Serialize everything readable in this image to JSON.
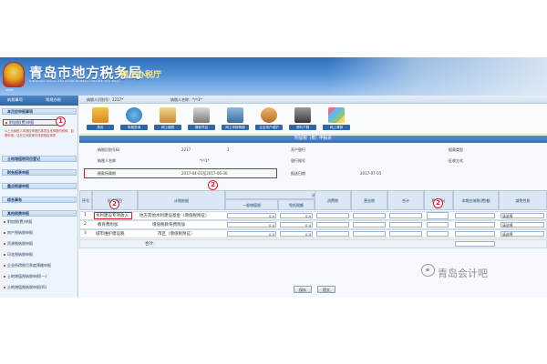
{
  "banner": {
    "title": "青岛市地方税务局",
    "subtitle": "网上办税厅",
    "emblem_text": "QDDS",
    "english": "QINGDAO LOCAL TAXATION BUREAU ONLINE TAX HALL"
  },
  "sidebar": {
    "tabs": [
      "纳税事项",
      "常规办税"
    ],
    "groups": [
      {
        "label": "本月应申报事项"
      },
      {
        "label": "土地增值税项目登记"
      },
      {
        "label": "财务报表申报"
      },
      {
        "label": "重点税源申报"
      },
      {
        "label": "综合事务"
      },
      {
        "label": "其他税费申报"
      }
    ],
    "highlighted_item": "附加税(费)申报",
    "note": "以上为纳税人本期应申报的事项及未申报的税种，如需申报，请在左侧菜单中找到相应事项",
    "items": [
      "附加税(费)申报",
      "房产税纳税申报",
      "资源税纳税申报",
      "印花税纳税申报",
      "企业所得税月季度预缴申报",
      "土地增值税纳税申报(一)",
      "土地增值税纳税申报(四)"
    ]
  },
  "user_bar": {
    "taxpayer_id": "纳税人识别号：2217*",
    "taxpayer_name": "纳税人名称：*户1*"
  },
  "toolbar": {
    "items": [
      {
        "label": "首页",
        "icon": "home-icon"
      },
      {
        "label": "申报查询",
        "icon": "globe-icon"
      },
      {
        "label": "网上缴税",
        "icon": "house-icon"
      },
      {
        "label": "缴款凭证",
        "icon": "printer-icon"
      },
      {
        "label": "网上申报明细",
        "icon": "building-icon"
      },
      {
        "label": "企业用户维护",
        "icon": "users-icon"
      },
      {
        "label": "资料下载",
        "icon": "download-icon"
      },
      {
        "label": "网上清算",
        "icon": "grid-icon"
      }
    ]
  },
  "form": {
    "title": "附加税（费）申报表",
    "fields": {
      "taxpayer_id_label": "纳税识别号码",
      "taxpayer_id_value": "2217",
      "taxpayer_id_suffix": "2",
      "taxpayer_name_label": "纳税人名称",
      "taxpayer_name_value": "*户1*",
      "period_label": "税款所属期",
      "period_value": "2017-04-01至2017-06-30",
      "bank_label": "开户银行",
      "bank_account_label": "银行账号",
      "report_date_label": "报送日期",
      "report_date_value": "2017-07-05",
      "report_type_label": "报表类型",
      "collection_label": "征收方式"
    },
    "headers": {
      "seq": "序号",
      "item": "征收项目",
      "basis": "计税依据",
      "tax_basis_group": "计税（费）依据",
      "vat_general": "一般增值税",
      "vat_exempt": "免抵税额",
      "consumption": "消费税",
      "business": "营业税",
      "total": "合计",
      "rate": "税率(%)",
      "current_payable": "本期应纳税(费)额",
      "deduction": "减免性质"
    },
    "rows": [
      {
        "seq": "1",
        "item": "水利建设专项收入",
        "basis": "地方其他水利建设基金（增值税附征）",
        "v1": "0.0",
        "v2": "0.0",
        "rate": "",
        "deduction": "请选择"
      },
      {
        "seq": "2",
        "item": "教育费附加",
        "basis": "增值税教育费附加",
        "v1": "0.0",
        "v2": "0.0",
        "rate": "",
        "deduction": "请选择"
      },
      {
        "seq": "3",
        "item": "城市维护建设税",
        "basis": "市区（增值税附征）",
        "v1": "0.0",
        "v2": "0.0",
        "rate": "",
        "deduction": "请选择"
      }
    ],
    "total_label": "合计：",
    "buttons": {
      "save": "保存",
      "submit": "提交"
    }
  },
  "badges": {
    "b1": "1",
    "b2": "2"
  },
  "watermark": "青岛会计吧",
  "colors": {
    "header_blue": "#2f6fba",
    "highlight_red": "#d41f2a"
  }
}
